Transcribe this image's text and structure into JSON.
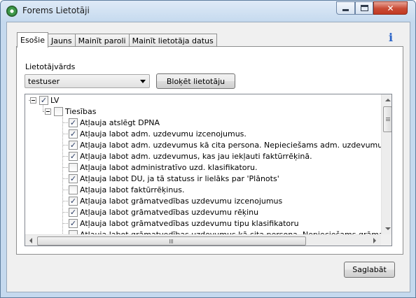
{
  "window": {
    "title": "Forems Lietotāji",
    "close_glyph": "✕"
  },
  "tabs": [
    {
      "label": "Esošie",
      "active": true
    },
    {
      "label": "Jauns",
      "active": false
    },
    {
      "label": "Mainīt paroli",
      "active": false
    },
    {
      "label": "Mainīt lietotāja datus",
      "active": false
    }
  ],
  "info_icon": {
    "glyph": "i",
    "icon": "info-icon"
  },
  "user_select": {
    "label": "Lietotājvārds",
    "value": "testuser"
  },
  "block_button": {
    "label": "Bloķēt lietotāju"
  },
  "tree": {
    "root": {
      "label": "LV",
      "checked": true
    },
    "group": {
      "label": "Tiesības",
      "checked": false
    },
    "items": [
      {
        "label": "Atļauja atslēgt DPNA",
        "checked": true
      },
      {
        "label": "Atļauja labot adm. uzdevumu izcenojumus.",
        "checked": true
      },
      {
        "label": "Atļauja labot adm. uzdevumus kā cita persona. Nepieciešams adm. uzdevumu koriģēšanai ar",
        "checked": true
      },
      {
        "label": "Atļauja labot adm. uzdevumus, kas jau iekļauti faktūrrēķinā.",
        "checked": true
      },
      {
        "label": "Atļauja labot administratīvo uzd. klasifikatoru.",
        "checked": false
      },
      {
        "label": "Atļauja labot DU, ja tā statuss ir lielāks par 'Plānots'",
        "checked": true
      },
      {
        "label": "Atļauja labot faktūrrēķinus.",
        "checked": false
      },
      {
        "label": "Atļauja labot grāmatvedības uzdevumu izcenojumus",
        "checked": true
      },
      {
        "label": "Atļauja labot grāmatvedības uzdevumu rēķinu",
        "checked": true
      },
      {
        "label": "Atļauja labot grāmatvedības uzdevumu tipu klasifikatoru",
        "checked": true
      },
      {
        "label": "Atļauja labot grāmatvedības uzdevumus kā cita persona. Nepieciešams grāmatvedības uzde",
        "checked": false
      }
    ]
  },
  "save_button": {
    "label": "Saglabāt"
  }
}
